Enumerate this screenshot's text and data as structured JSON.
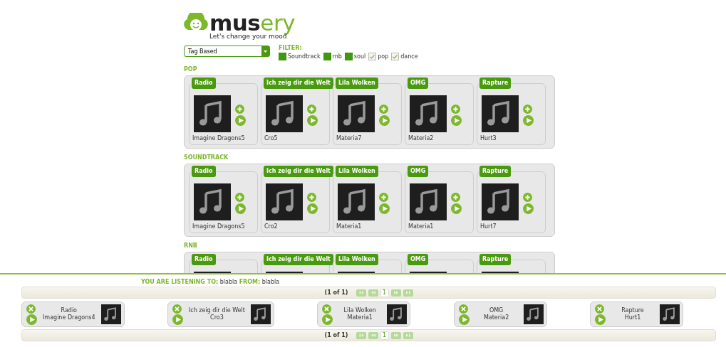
{
  "logo": {
    "name": "musery",
    "tagline": "Let's change your mood"
  },
  "mode_select": {
    "value": "Tag Based"
  },
  "filter": {
    "label": "FILTER:",
    "tags": [
      {
        "label": "Soundtrack",
        "checked": false
      },
      {
        "label": "rnb",
        "checked": false
      },
      {
        "label": "soul",
        "checked": false
      },
      {
        "label": "pop",
        "checked": true
      },
      {
        "label": "dance",
        "checked": true
      }
    ]
  },
  "sections": [
    {
      "title": "POP",
      "tracks": [
        {
          "title": "Radio",
          "artist": "Imagine Dragons5"
        },
        {
          "title": "Ich zeig dir die Welt",
          "artist": "Cro5"
        },
        {
          "title": "Lila Wolken",
          "artist": "Materia7"
        },
        {
          "title": "OMG",
          "artist": "Materia2"
        },
        {
          "title": "Rapture",
          "artist": "Hurt3"
        }
      ]
    },
    {
      "title": "SOUNDTRACK",
      "tracks": [
        {
          "title": "Radio",
          "artist": "Imagine Dragons5"
        },
        {
          "title": "Ich zeig dir die Welt",
          "artist": "Cro2"
        },
        {
          "title": "Lila Wolken",
          "artist": "Materia1"
        },
        {
          "title": "OMG",
          "artist": "Materia1"
        },
        {
          "title": "Rapture",
          "artist": "Hurt7"
        }
      ]
    },
    {
      "title": "RNB",
      "tracks": [
        {
          "title": "Radio"
        },
        {
          "title": "Ich zeig dir die Welt"
        },
        {
          "title": "Lila Wolken"
        },
        {
          "title": "OMG"
        },
        {
          "title": "Rapture"
        }
      ]
    }
  ],
  "player": {
    "listening_label": "YOU ARE LISTENING TO:",
    "listening_value": "blabla",
    "from_label": "FROM:",
    "from_value": "blabla",
    "pager_top": {
      "report": "(1 of 1)",
      "page": "1"
    },
    "pager_bottom": {
      "report": "(1 of 1)",
      "page": "1"
    },
    "playlist": [
      {
        "title": "Radio",
        "artist": "Imagine Dragons4"
      },
      {
        "title": "Ich zeig dir die Welt",
        "artist": "Cro3"
      },
      {
        "title": "Lila Wolken",
        "artist": "Materia1"
      },
      {
        "title": "OMG",
        "artist": "Materia2"
      },
      {
        "title": "Rapture",
        "artist": "Hurt1"
      }
    ]
  }
}
